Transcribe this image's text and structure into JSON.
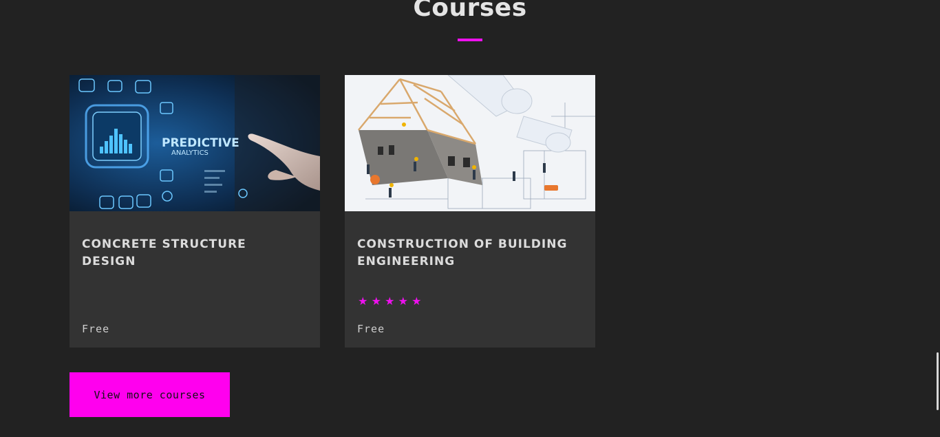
{
  "section": {
    "title": "Courses",
    "accent_color": "#ee11ee"
  },
  "courses": [
    {
      "title": "CONCRETE STRUCTURE DESIGN",
      "image_icon": "predictive-analytics-image",
      "image_text_1": "PREDICTIVE",
      "image_text_2": "ANALYTICS",
      "price": "Free",
      "rating": null
    },
    {
      "title": "CONSTRUCTION OF BUILDING ENGINEERING",
      "image_icon": "house-construction-image",
      "stars": [
        "★",
        "★",
        "★",
        "★",
        "★"
      ],
      "rating": 5,
      "price": "Free"
    }
  ],
  "cta": {
    "label": "View more courses",
    "color": "#ff00ee"
  }
}
